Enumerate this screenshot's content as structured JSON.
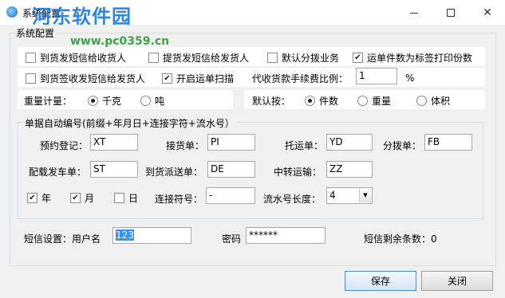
{
  "window": {
    "title": "系统配置",
    "watermark": "河东软件园",
    "watermark_url": "www.pc0359.cn"
  },
  "group": {
    "title": "系统配置"
  },
  "options": {
    "row1": [
      {
        "label": "到货发短信给收货人",
        "checked": false
      },
      {
        "label": "提货发短信给发货人",
        "checked": false
      },
      {
        "label": "默认分拨业务",
        "checked": false
      },
      {
        "label": "运单件数为标签打印份数",
        "checked": true
      }
    ],
    "row2": [
      {
        "label": "到货签收发短信给发货人",
        "checked": false
      },
      {
        "label": "开启运单扫描",
        "checked": true
      }
    ],
    "fee_ratio_label": "代收货款手续费比例：",
    "fee_ratio_value": "1",
    "fee_ratio_unit": "%"
  },
  "weight": {
    "label": "重量计量：",
    "options": [
      "千克",
      "吨"
    ],
    "selected": "千克"
  },
  "default_by": {
    "label": "默认按：",
    "options": [
      "件数",
      "重量",
      "体积"
    ],
    "selected": "件数"
  },
  "numbering": {
    "title": "单据自动编号(前缀+年月日+连接字符+流水号）",
    "fields": {
      "appointment": {
        "label": "预约登记：",
        "value": "XT"
      },
      "receipt": {
        "label": "接货单：",
        "value": "PI"
      },
      "consignment": {
        "label": "托运单：",
        "value": "YD"
      },
      "dispatch": {
        "label": "分拨单：",
        "value": "FB"
      },
      "loading": {
        "label": "配载发车单：",
        "value": "ST"
      },
      "delivery": {
        "label": "到货派送单：",
        "value": "DE"
      },
      "transfer": {
        "label": "中转运输：",
        "value": "ZZ"
      }
    },
    "year": {
      "label": "年",
      "checked": true
    },
    "month": {
      "label": "月",
      "checked": true
    },
    "day": {
      "label": "日",
      "checked": false
    },
    "connector_label": "连接符号：",
    "connector_value": "-",
    "serial_label": "流水号长度：",
    "serial_value": "4"
  },
  "sms": {
    "user_label": "短信设置：用户名",
    "user_value": "123",
    "password_label": "密码",
    "password_value": "******",
    "remaining_label": "短信剩余条数：0"
  },
  "buttons": {
    "save": "保存",
    "close": "关闭"
  }
}
